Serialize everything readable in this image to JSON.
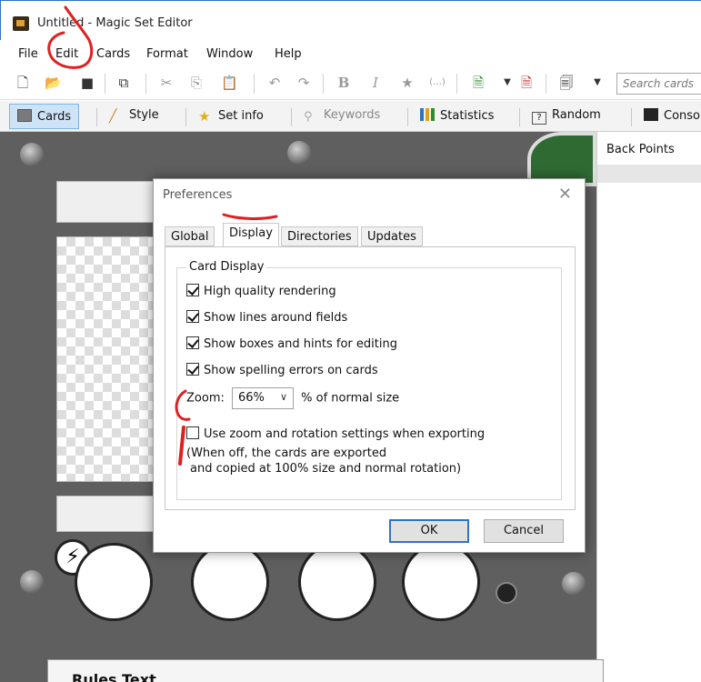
{
  "window": {
    "title": "Untitled - Magic Set Editor"
  },
  "menu": {
    "items": [
      "File",
      "Edit",
      "Cards",
      "Format",
      "Window",
      "Help"
    ]
  },
  "toolbar": {
    "icons": [
      "new-file-icon",
      "open-folder-icon",
      "save-icon",
      "export-icon",
      "cut-icon",
      "copy-icon",
      "paste-icon",
      "undo-icon",
      "redo-icon",
      "bold-icon",
      "italic-icon",
      "symbol-icon",
      "reminder-text-icon",
      "add-card-icon",
      "dropdown-icon",
      "remove-card-icon",
      "card-style-icon",
      "dropdown-icon"
    ],
    "search_placeholder": "Search cards"
  },
  "tabs": [
    {
      "label": "Cards",
      "icon": "cards-icon",
      "active": true
    },
    {
      "label": "Style",
      "icon": "style-brush-icon",
      "active": false
    },
    {
      "label": "Set info",
      "icon": "star-icon",
      "active": false
    },
    {
      "label": "Keywords",
      "icon": "keywords-icon",
      "active": false
    },
    {
      "label": "Statistics",
      "icon": "bar-chart-icon",
      "active": false
    },
    {
      "label": "Random",
      "icon": "dice-icon",
      "active": false
    },
    {
      "label": "Conso",
      "icon": "console-icon",
      "active": false
    }
  ],
  "sidebar": {
    "column_header": "Back Points"
  },
  "card": {
    "rules_label": "Rules Text"
  },
  "dialog": {
    "title": "Preferences",
    "tabs": [
      {
        "label": "Global",
        "active": false
      },
      {
        "label": "Display",
        "active": true
      },
      {
        "label": "Directories",
        "active": false
      },
      {
        "label": "Updates",
        "active": false
      }
    ],
    "group_label": "Card Display",
    "checks": [
      {
        "label": "High quality rendering",
        "checked": true
      },
      {
        "label": "Show lines around fields",
        "checked": true
      },
      {
        "label": "Show boxes and hints for editing",
        "checked": true
      },
      {
        "label": "Show spelling errors on cards",
        "checked": true
      }
    ],
    "zoom": {
      "label": "Zoom:",
      "value": "66%",
      "suffix": "% of normal size"
    },
    "export_option": {
      "label": "Use zoom and rotation settings when exporting",
      "checked": false
    },
    "note_line1": "(When off, the cards are exported",
    "note_line2": "and copied at 100% size and normal rotation)",
    "ok_label": "OK",
    "cancel_label": "Cancel"
  },
  "colors": {
    "annotation": "#e02020",
    "accent": "#2f74c0",
    "active_tab": "#cfe3f6"
  }
}
